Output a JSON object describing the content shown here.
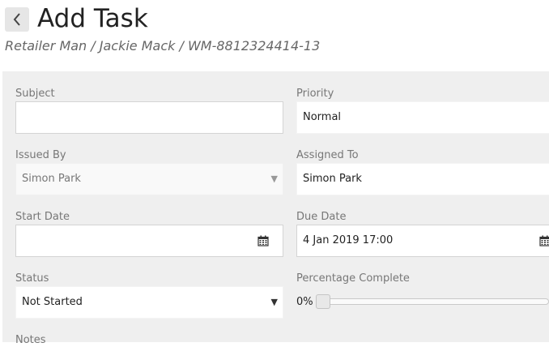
{
  "header": {
    "title": "Add Task",
    "breadcrumb": "Retailer Man / Jackie Mack / WM-8812324414-13"
  },
  "form": {
    "subject": {
      "label": "Subject",
      "value": ""
    },
    "priority": {
      "label": "Priority",
      "value": "Normal"
    },
    "issued_by": {
      "label": "Issued By",
      "value": "Simon Park"
    },
    "assigned_to": {
      "label": "Assigned To",
      "value": "Simon Park"
    },
    "start_date": {
      "label": "Start Date",
      "value": ""
    },
    "due_date": {
      "label": "Due Date",
      "value": "4 Jan 2019 17:00"
    },
    "status": {
      "label": "Status",
      "value": "Not Started"
    },
    "percentage": {
      "label": "Percentage Complete",
      "value_text": "0%",
      "value": 0
    },
    "notes": {
      "label": "Notes"
    }
  },
  "icons": {
    "back": "chevron-left-icon",
    "calendar": "calendar-icon",
    "dropdown": "caret-down-icon"
  },
  "colors": {
    "panel_background": "#efefef",
    "field_border": "#d4d4d4",
    "label_text": "#777777"
  }
}
